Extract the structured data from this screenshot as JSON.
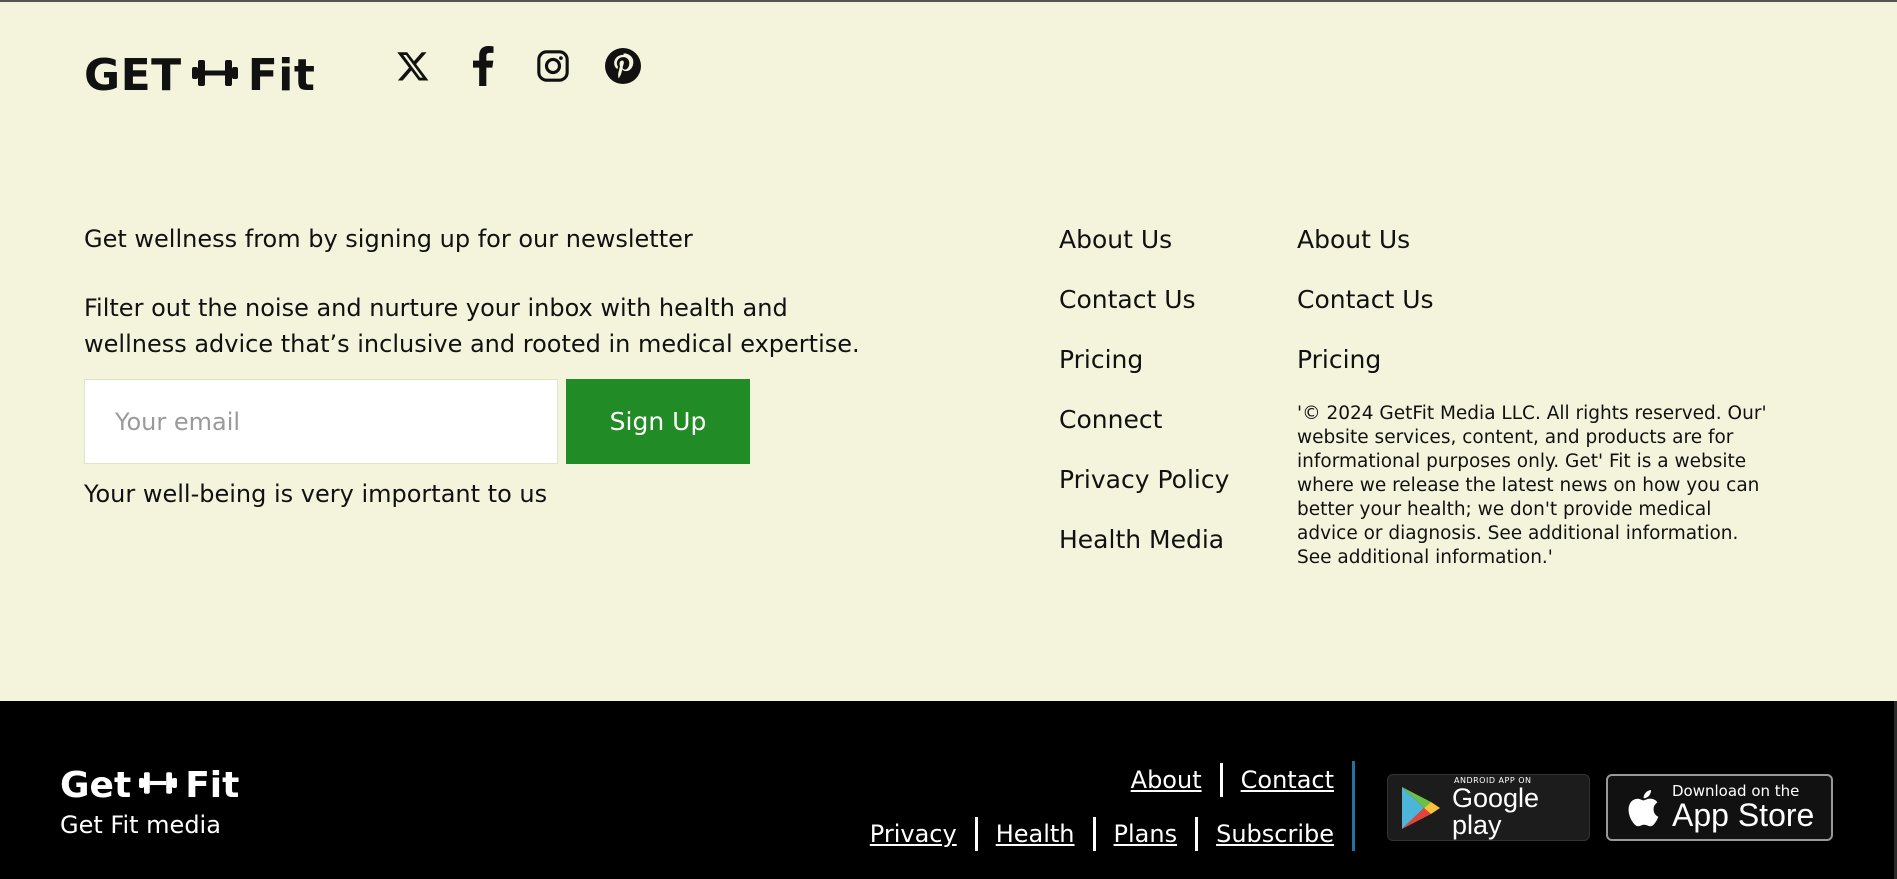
{
  "brand": {
    "logo_left": "GET",
    "logo_right": "Fit"
  },
  "socials": [
    {
      "icon": "x-twitter-icon"
    },
    {
      "icon": "facebook-icon"
    },
    {
      "icon": "instagram-icon"
    },
    {
      "icon": "pinterest-icon"
    }
  ],
  "newsletter": {
    "title": "Get wellness from by signing up for our newsletter",
    "description": "Filter out the noise and nurture your inbox with health and wellness advice that’s inclusive and rooted in medical expertise.",
    "email_placeholder": "Your email",
    "email_value": "",
    "button_label": "Sign Up",
    "footer_note": "Your well-being is very important to us"
  },
  "links_col1": [
    "About Us",
    "Contact Us",
    "Pricing",
    "Connect",
    "Privacy Policy",
    "Health Media"
  ],
  "links_col2": [
    "About Us",
    "Contact Us",
    "Pricing"
  ],
  "copyright": "'© 2024 GetFit Media LLC. All rights reserved. Our' website services, content, and products are for informational purposes only. Get' Fit is a website where we release the latest news on how you can better your health; we don't provide medical advice or diagnosis. See additional information. See additional information.'",
  "bottom": {
    "logo_left": "Get",
    "logo_right": "Fit",
    "subtitle": "Get Fit media",
    "links_row1": [
      "About",
      "Contact"
    ],
    "links_row2": [
      "Privacy",
      "Health",
      "Plans",
      "Subscribe"
    ],
    "google_play": {
      "small": "ANDROID APP ON",
      "big": "Google play"
    },
    "app_store": {
      "small": "Download on the",
      "big": "App Store"
    }
  },
  "colors": {
    "upper_bg": "#f4f4dc",
    "signup_green": "#218c26",
    "lower_bg": "#000000",
    "divider_blue": "#2b6f9e"
  }
}
